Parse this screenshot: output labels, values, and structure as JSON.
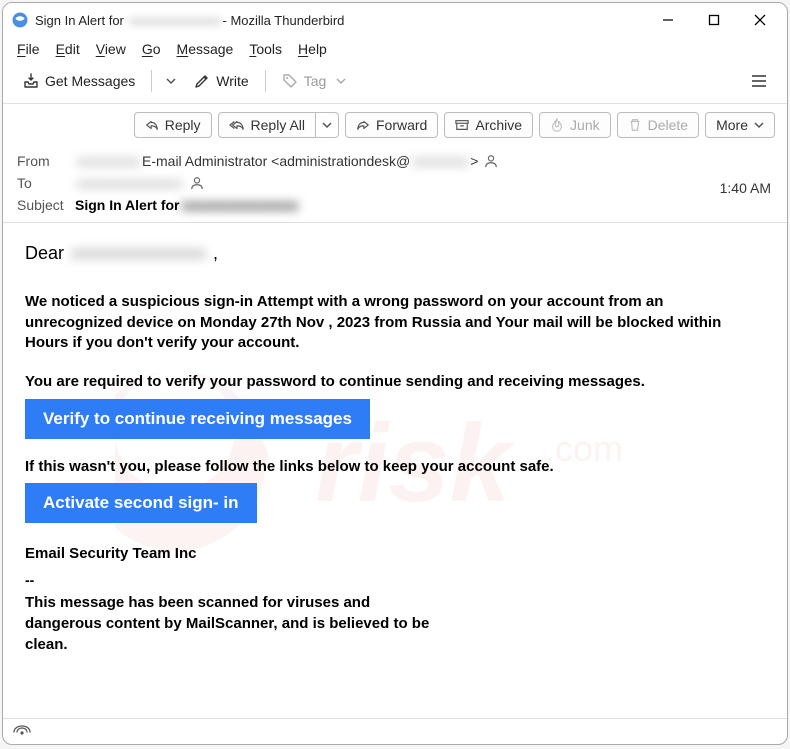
{
  "window": {
    "title_prefix": "Sign In Alert for",
    "title_redacted": "xxxxxxxxxxxxxx",
    "title_suffix": " - Mozilla Thunderbird"
  },
  "menu": {
    "file": "File",
    "edit": "Edit",
    "view": "View",
    "go": "Go",
    "message": "Message",
    "tools": "Tools",
    "help": "Help"
  },
  "toolbar": {
    "get_messages": "Get Messages",
    "write": "Write",
    "tag": "Tag"
  },
  "actions": {
    "reply": "Reply",
    "reply_all": "Reply All",
    "forward": "Forward",
    "archive": "Archive",
    "junk": "Junk",
    "delete": "Delete",
    "more": "More"
  },
  "headers": {
    "from_label": "From",
    "from_name_redacted": "xxxxxxxxx",
    "from_display": " E-mail Administrator <administrationdesk@",
    "from_domain_redacted": "xxxxxxxx",
    "from_close": " >",
    "to_label": "To",
    "to_redacted": "xxxxxxxxxxxxxxx",
    "time": "1:40 AM",
    "subject_label": "Subject",
    "subject_prefix": "Sign In Alert for ",
    "subject_redacted": "xxxxxxxxxxxxxxx"
  },
  "body": {
    "greet_prefix": "Dear  ",
    "greet_redacted": "xxxxxxxxxxxxxxx",
    "greet_suffix": " ,",
    "p1": "We noticed a suspicious sign-in Attempt with a wrong password on your account from an unrecognized device on Monday 27th Nov , 2023 from Russia and Your mail will be blocked within Hours if you don't verify your account.",
    "p2": "You are required to verify your password to continue sending and receiving messages.",
    "cta1": "Verify to continue receiving messages",
    "p3": "If this wasn't you, please follow the links below to keep your account safe.",
    "cta2": "Activate second sign- in",
    "sig": "Email Security Team Inc",
    "dash": "--",
    "footer_a": "This message has been scanned for viruses and dangerous content by  ",
    "footer_scanner": "MailScanner",
    "footer_b": ", and is believed to be clean."
  },
  "status": {
    "icon_text": "((○))"
  }
}
